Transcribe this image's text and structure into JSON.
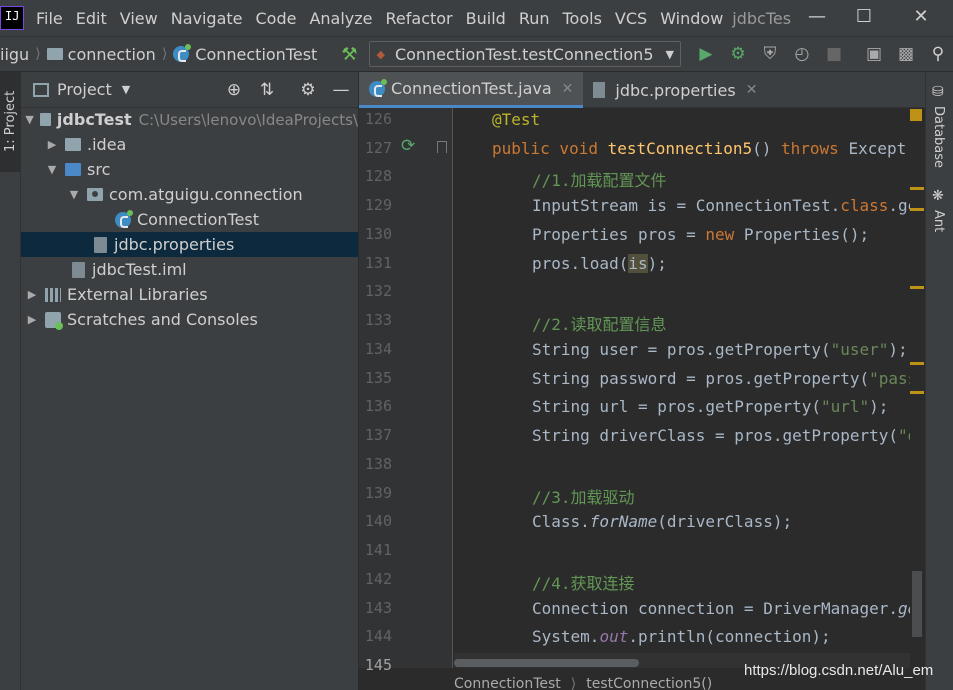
{
  "app": {
    "window_title": "jdbcTes",
    "menu": [
      "File",
      "Edit",
      "View",
      "Navigate",
      "Code",
      "Analyze",
      "Refactor",
      "Build",
      "Run",
      "Tools",
      "VCS",
      "Window"
    ]
  },
  "navbar": {
    "crumbs": [
      "iigu",
      "connection",
      "ConnectionTest"
    ],
    "run_config": "ConnectionTest.testConnection5"
  },
  "left_stripe": {
    "project_tab": "1: Project"
  },
  "project_panel": {
    "title": "Project",
    "root_name": "jdbcTest",
    "root_path": "C:\\Users\\lenovo\\IdeaProjects\\",
    "items": {
      "idea": ".idea",
      "src": "src",
      "package": "com.atguigu.connection",
      "class": "ConnectionTest",
      "props": "jdbc.properties",
      "iml": "jdbcTest.iml",
      "libs": "External Libraries",
      "scratches": "Scratches and Consoles"
    }
  },
  "editor": {
    "tabs": [
      {
        "label": "ConnectionTest.java",
        "active": true
      },
      {
        "label": "jdbc.properties",
        "active": false
      }
    ],
    "line_numbers": [
      "126",
      "127",
      "128",
      "129",
      "130",
      "131",
      "132",
      "133",
      "134",
      "135",
      "136",
      "137",
      "138",
      "139",
      "140",
      "141",
      "142",
      "143",
      "144",
      "145"
    ],
    "code": {
      "l126_ann": "@Test",
      "l127_kw1": "public void ",
      "l127_fn": "testConnection5",
      "l127_mid": "() ",
      "l127_kw2": "throws ",
      "l127_rest": "Except",
      "l128_cm": "//1.加载配置文件",
      "l129_a": "InputStream is = ConnectionTest.",
      "l129_kw": "class",
      "l129_b": ".ge",
      "l130_a": "Properties pros = ",
      "l130_kw": "new ",
      "l130_b": "Properties();",
      "l131_a": "pros.load(",
      "l131_hl": "is",
      "l131_b": ");",
      "l133_cm": "//2.读取配置信息",
      "l134_a": "String user = pros.getProperty(",
      "l134_str": "\"user\"",
      "l134_b": ");",
      "l135_a": "String password = pros.getProperty(",
      "l135_str": "\"pass",
      "l136_a": "String url = pros.getProperty(",
      "l136_str": "\"url\"",
      "l136_b": ");",
      "l137_a": "String driverClass = pros.getProperty(",
      "l137_str": "\"d",
      "l139_cm": "//3.加载驱动",
      "l140_a": "Class.",
      "l140_it": "forName",
      "l140_b": "(driverClass);",
      "l142_cm": "//4.获取连接",
      "l143_a": "Connection connection = DriverManager.",
      "l143_it": "ge",
      "l144_a": "System.",
      "l144_fld": "out",
      "l144_b": ".println(connection);"
    },
    "breadcrumbs": [
      "ConnectionTest",
      "testConnection5()"
    ]
  },
  "right_stripe": {
    "tabs": [
      "Database",
      "Ant"
    ]
  },
  "watermark": "https://blog.csdn.net/Alu_em",
  "colors": {
    "accent": "#4a88c7",
    "keyword": "#cc7832",
    "function": "#ffc66d",
    "comment": "#629755",
    "string": "#6a8759"
  }
}
